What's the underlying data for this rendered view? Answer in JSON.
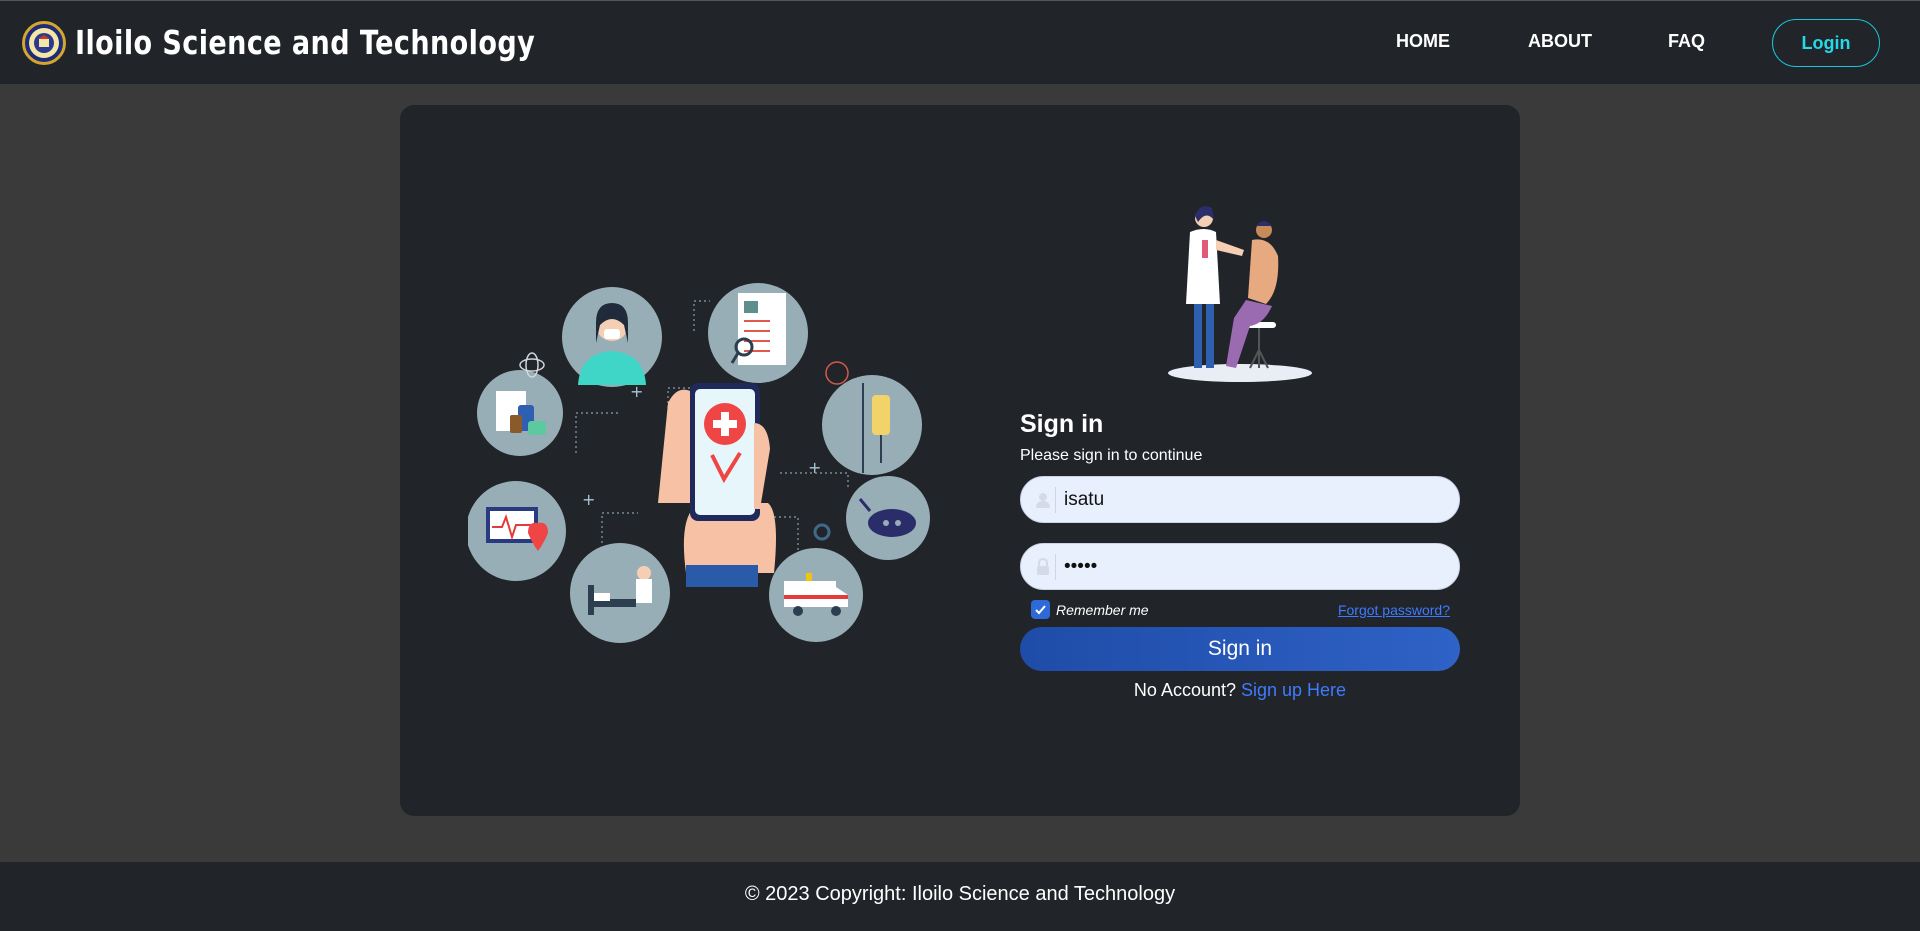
{
  "brand": {
    "title": "Iloilo Science and Technology",
    "logo_icon": "university-seal-icon"
  },
  "nav": {
    "home": "HOME",
    "about": "ABOUT",
    "faq": "FAQ",
    "login": "Login"
  },
  "signin": {
    "title": "Sign in",
    "subtitle": "Please sign in to continue",
    "username_value": "isatu",
    "password_value": "•••••",
    "remember_label": "Remember me",
    "remember_checked": true,
    "forgot_label": "Forgot password?",
    "button_label": "Sign in",
    "no_account_text": "No Account?",
    "signup_label": "Sign up Here"
  },
  "footer": {
    "copyright": "© 2023 Copyright: Iloilo Science and Technology"
  },
  "colors": {
    "navbar_bg": "#212529",
    "page_bg": "#3a3a3a",
    "card_bg": "#212429",
    "accent_cyan": "#25d7e8",
    "button_blue": "#2f62c6",
    "link_blue": "#3d7bff"
  }
}
